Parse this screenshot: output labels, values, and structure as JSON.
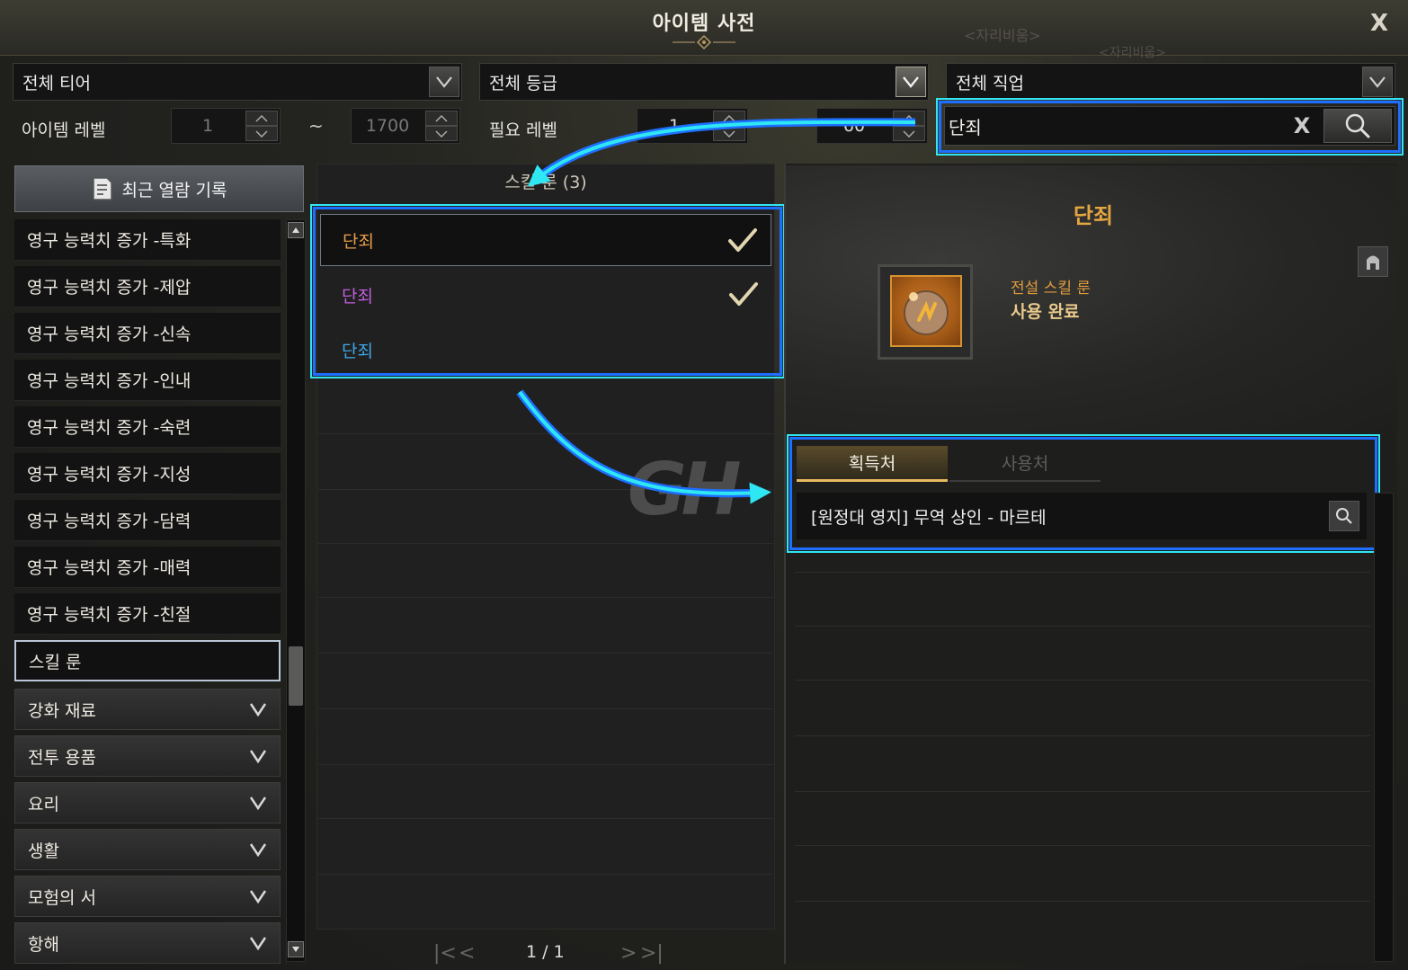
{
  "window": {
    "title": "아이템 사전",
    "close_label": "X",
    "ghost_text_1": "<자리비움>",
    "ghost_text_2": "<자리비움>"
  },
  "filters": {
    "tier": "전체 티어",
    "grade": "전체 등급",
    "class": "전체 직업",
    "item_level_label": "아이템 레벨",
    "item_level_min": "1",
    "item_level_max": "1700",
    "range_sep": "~",
    "required_level_label": "필요 레벨",
    "required_level_min": "1",
    "required_level_max": "60"
  },
  "search": {
    "value": "단죄",
    "clear_label": "X"
  },
  "sidebar": {
    "recent_label": "최근 열람 기록",
    "items": [
      {
        "label": "영구 능력치 증가 -특화"
      },
      {
        "label": "영구 능력치 증가 -제압"
      },
      {
        "label": "영구 능력치 증가 -신속"
      },
      {
        "label": "영구 능력치 증가 -인내"
      },
      {
        "label": "영구 능력치 증가 -숙련"
      },
      {
        "label": "영구 능력치 증가 -지성"
      },
      {
        "label": "영구 능력치 증가 -담력"
      },
      {
        "label": "영구 능력치 증가 -매력"
      },
      {
        "label": "영구 능력치 증가 -친절"
      },
      {
        "label": "스킬 룬"
      }
    ],
    "groups": [
      {
        "label": "강화 재료"
      },
      {
        "label": "전투 용품"
      },
      {
        "label": "요리"
      },
      {
        "label": "생활"
      },
      {
        "label": "모험의 서"
      },
      {
        "label": "항해"
      }
    ]
  },
  "results": {
    "header": "스킬 룬 (3)",
    "items": [
      {
        "name": "단죄",
        "color": "#e9a04a",
        "checked": true
      },
      {
        "name": "단죄",
        "color": "#c25ee0",
        "checked": true
      },
      {
        "name": "단죄",
        "color": "#3fa9e8",
        "checked": false
      }
    ],
    "page": "1 / 1"
  },
  "detail": {
    "name": "단죄",
    "grade": "전설 스킬 룬",
    "status": "사용 완료",
    "tabs": [
      {
        "label": "획득처",
        "active": true
      },
      {
        "label": "사용처",
        "active": false
      }
    ],
    "sources": [
      {
        "label": "[원정대 영지] 무역 상인 - 마르테"
      }
    ]
  },
  "watermark": "GH",
  "colors": {
    "highlight_outer": "#1e6fff",
    "highlight_inner": "#2fe6f3",
    "title_gold": "#e4a640"
  }
}
